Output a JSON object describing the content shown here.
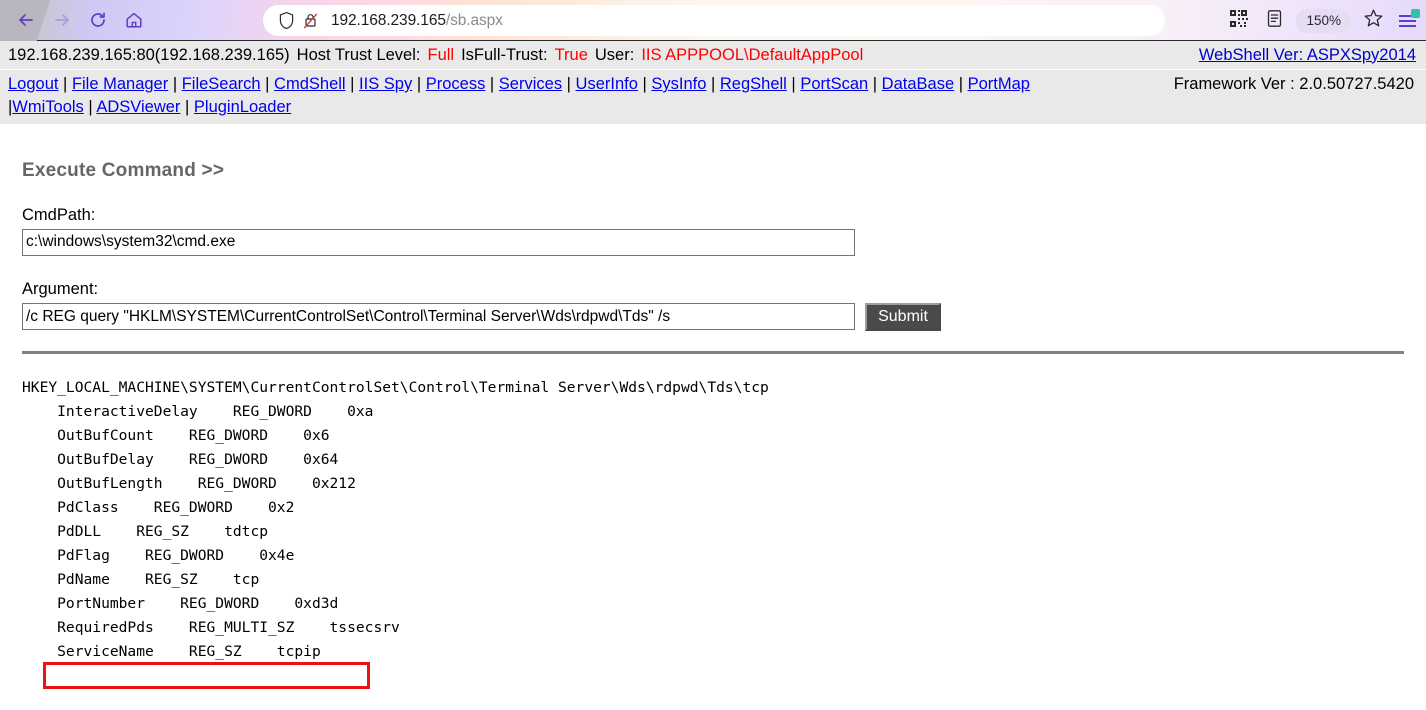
{
  "browser": {
    "back_icon": "back-arrow-icon",
    "forward_icon": "forward-arrow-icon",
    "reload_icon": "reload-icon",
    "home_icon": "home-icon",
    "shield_icon": "shield-icon",
    "insecure_icon": "insecure-lock-icon",
    "url_host": "192.168.239.165",
    "url_path": "/sb.aspx",
    "qr_icon": "qr-code-icon",
    "reader_icon": "reader-view-icon",
    "zoom_level": "150%",
    "bookmark_icon": "star-icon",
    "menu_icon": "hamburger-menu-icon"
  },
  "infobar": {
    "server": "192.168.239.165:80(192.168.239.165)",
    "trust_label": "Host Trust Level:",
    "trust_value": "Full",
    "isfull_label": "IsFull-Trust:",
    "isfull_value": "True",
    "user_label": "User:",
    "user_value": "IIS APPPOOL\\DefaultAppPool",
    "webshell_ver": "WebShell Ver: ASPXSpy2014"
  },
  "nav": {
    "links": [
      "Logout",
      "File Manager",
      "FileSearch",
      "CmdShell",
      "IIS Spy",
      "Process",
      "Services",
      "UserInfo",
      "SysInfo",
      "RegShell",
      "PortScan",
      "DataBase",
      "PortMap",
      "WmiTools",
      "ADSViewer",
      "PluginLoader"
    ],
    "framework_ver": "Framework Ver : 2.0.50727.5420"
  },
  "form": {
    "title": "Execute Command >>",
    "cmdpath_label": "CmdPath:",
    "cmdpath_value": "c:\\windows\\system32\\cmd.exe",
    "cmdpath_placeholder": "",
    "argument_label": "Argument:",
    "argument_value": "/c REG query \"HKLM\\SYSTEM\\CurrentControlSet\\Control\\Terminal Server\\Wds\\rdpwd\\Tds\" /s",
    "argument_placeholder": "",
    "submit_label": "Submit"
  },
  "output": {
    "text": "HKEY_LOCAL_MACHINE\\SYSTEM\\CurrentControlSet\\Control\\Terminal Server\\Wds\\rdpwd\\Tds\\tcp\n    InteractiveDelay    REG_DWORD    0xa\n    OutBufCount    REG_DWORD    0x6\n    OutBufDelay    REG_DWORD    0x64\n    OutBufLength    REG_DWORD    0x212\n    PdClass    REG_DWORD    0x2\n    PdDLL    REG_SZ    tdtcp\n    PdFlag    REG_DWORD    0x4e\n    PdName    REG_SZ    tcp\n    PortNumber    REG_DWORD    0xd3d\n    RequiredPds    REG_MULTI_SZ    tssecsrv\n    ServiceName    REG_SZ    tcpip",
    "highlighted_row": "PortNumber    REG_DWORD    0xd3d",
    "highlight_color": "#ee1111"
  },
  "colors": {
    "infobar_bg": "#e9e9e9",
    "link": "#0000ee",
    "danger": "#ff0000",
    "heading": "#666666",
    "divider": "#808080"
  }
}
